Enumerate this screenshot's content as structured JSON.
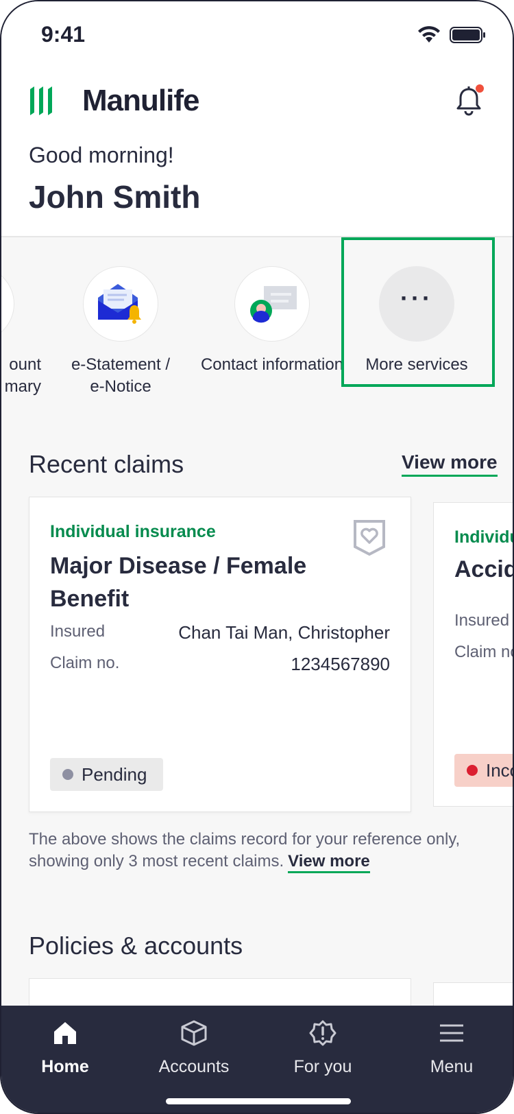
{
  "status_bar": {
    "time": "9:41"
  },
  "header": {
    "brand": "Manulife",
    "greeting": "Good morning!",
    "user_name": "John Smith",
    "notification_dot_color": "#f0503c"
  },
  "services": {
    "partial_label_line1": "ount",
    "partial_label_line2": "mary",
    "items": [
      {
        "label_line1": "e-Statement /",
        "label_line2": "e-Notice",
        "icon": "envelope-bell-icon"
      },
      {
        "label_line1": "Contact information",
        "label_line2": "",
        "icon": "contact-card-icon"
      },
      {
        "label_line1": "More services",
        "label_line2": "",
        "icon": "more-dots-icon"
      }
    ],
    "more_dots": "···"
  },
  "recent_claims": {
    "title": "Recent claims",
    "view_more": "View more",
    "cards": [
      {
        "type": "Individual insurance",
        "title": "Major Disease / Female Benefit",
        "insured_label": "Insured",
        "insured_value": "Chan Tai Man, Christopher",
        "claim_label": "Claim no.",
        "claim_value": "1234567890",
        "status": "Pending"
      },
      {
        "type": "Individu",
        "title": "Accid",
        "insured_label": "Insured",
        "claim_label": "Claim no",
        "status": "Inco"
      }
    ],
    "disclaimer": "The above shows the claims record for your reference only, showing only 3 most recent claims.",
    "disclaimer_link": "View more"
  },
  "policies": {
    "title": "Policies & accounts"
  },
  "bottom_nav": {
    "items": [
      {
        "label": "Home",
        "icon": "home-icon",
        "active": true
      },
      {
        "label": "Accounts",
        "icon": "box-icon",
        "active": false
      },
      {
        "label": "For you",
        "icon": "badge-alert-icon",
        "active": false
      },
      {
        "label": "Menu",
        "icon": "hamburger-icon",
        "active": false
      }
    ]
  },
  "colors": {
    "brand_green": "#00a758",
    "text_green": "#068b4e",
    "navy": "#282b3e",
    "pending_dot": "#8e90a2",
    "incomplete_dot": "#db1f30"
  }
}
